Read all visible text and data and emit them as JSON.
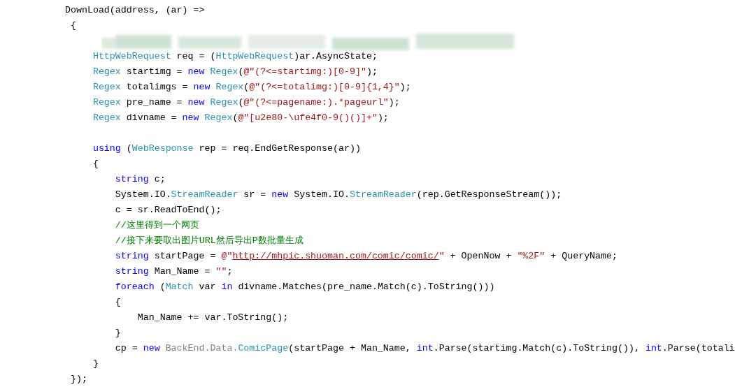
{
  "code_lines": [
    {
      "kind": "code",
      "tokens": [
        {
          "kind": "plain",
          "t": "DownLoad(address, (ar) =>"
        }
      ]
    },
    {
      "kind": "code",
      "tokens": [
        {
          "kind": "plain",
          "t": " {"
        }
      ]
    },
    {
      "kind": "blurred"
    },
    {
      "kind": "code",
      "tokens": [
        {
          "kind": "type",
          "t": "     HttpWebRequest"
        },
        {
          "kind": "plain",
          "t": " req = ("
        },
        {
          "kind": "type",
          "t": "HttpWebRequest"
        },
        {
          "kind": "plain",
          "t": ")ar.AsyncState;"
        }
      ]
    },
    {
      "kind": "code",
      "tokens": [
        {
          "kind": "type",
          "t": "     Regex"
        },
        {
          "kind": "plain",
          "t": " startimg = "
        },
        {
          "kind": "keyword",
          "t": "new "
        },
        {
          "kind": "type",
          "t": "Regex"
        },
        {
          "kind": "plain",
          "t": "("
        },
        {
          "kind": "string",
          "t": "@\"(?<=startimg:)[0-9]\""
        },
        {
          "kind": "plain",
          "t": ");"
        }
      ]
    },
    {
      "kind": "code",
      "tokens": [
        {
          "kind": "type",
          "t": "     Regex"
        },
        {
          "kind": "plain",
          "t": " totalimgs = "
        },
        {
          "kind": "keyword",
          "t": "new "
        },
        {
          "kind": "type",
          "t": "Regex"
        },
        {
          "kind": "plain",
          "t": "("
        },
        {
          "kind": "string",
          "t": "@\"(?<=totalimg:)[0-9]{1,4}\""
        },
        {
          "kind": "plain",
          "t": ");"
        }
      ]
    },
    {
      "kind": "code",
      "tokens": [
        {
          "kind": "type",
          "t": "     Regex"
        },
        {
          "kind": "plain",
          "t": " pre_name = "
        },
        {
          "kind": "keyword",
          "t": "new "
        },
        {
          "kind": "type",
          "t": "Regex"
        },
        {
          "kind": "plain",
          "t": "("
        },
        {
          "kind": "string",
          "t": "@\"(?<=pagename:).*pageurl\""
        },
        {
          "kind": "plain",
          "t": ");"
        }
      ]
    },
    {
      "kind": "code",
      "tokens": [
        {
          "kind": "type",
          "t": "     Regex"
        },
        {
          "kind": "plain",
          "t": " divname = "
        },
        {
          "kind": "keyword",
          "t": "new "
        },
        {
          "kind": "type",
          "t": "Regex"
        },
        {
          "kind": "plain",
          "t": "("
        },
        {
          "kind": "string",
          "t": "@\"[u2e80-\\ufe4f0-9()()]+\""
        },
        {
          "kind": "plain",
          "t": ");"
        }
      ]
    },
    {
      "kind": "blank"
    },
    {
      "kind": "code",
      "tokens": [
        {
          "kind": "keyword",
          "t": "     using"
        },
        {
          "kind": "plain",
          "t": " ("
        },
        {
          "kind": "type",
          "t": "WebResponse"
        },
        {
          "kind": "plain",
          "t": " rep = req.EndGetResponse(ar))"
        }
      ]
    },
    {
      "kind": "code",
      "tokens": [
        {
          "kind": "plain",
          "t": "     {"
        }
      ]
    },
    {
      "kind": "code",
      "tokens": [
        {
          "kind": "keyword",
          "t": "         string"
        },
        {
          "kind": "plain",
          "t": " c;"
        }
      ]
    },
    {
      "kind": "code",
      "tokens": [
        {
          "kind": "plain",
          "t": "         System.IO."
        },
        {
          "kind": "type",
          "t": "StreamReader"
        },
        {
          "kind": "plain",
          "t": " sr = "
        },
        {
          "kind": "keyword",
          "t": "new"
        },
        {
          "kind": "plain",
          "t": " System.IO."
        },
        {
          "kind": "type",
          "t": "StreamReader"
        },
        {
          "kind": "plain",
          "t": "(rep.GetResponseStream());"
        }
      ]
    },
    {
      "kind": "code",
      "tokens": [
        {
          "kind": "plain",
          "t": "         c = sr.ReadToEnd();"
        }
      ]
    },
    {
      "kind": "code",
      "tokens": [
        {
          "kind": "comment",
          "t": "         //这里得到一个网页"
        }
      ]
    },
    {
      "kind": "code",
      "tokens": [
        {
          "kind": "comment",
          "t": "         //接下来要取出图片URL然后导出P数批量生成"
        }
      ]
    },
    {
      "kind": "code",
      "tokens": [
        {
          "kind": "keyword",
          "t": "         string"
        },
        {
          "kind": "plain",
          "t": " startPage = "
        },
        {
          "kind": "string",
          "t": "@\""
        },
        {
          "kind": "link",
          "t": "http://mhpic.shuoman.com/comic/comic/"
        },
        {
          "kind": "string",
          "t": "\""
        },
        {
          "kind": "plain",
          "t": " + OpenNow + "
        },
        {
          "kind": "string",
          "t": "\"%2F\""
        },
        {
          "kind": "plain",
          "t": " + QueryName;"
        }
      ]
    },
    {
      "kind": "code",
      "tokens": [
        {
          "kind": "keyword",
          "t": "         string"
        },
        {
          "kind": "plain",
          "t": " Man_Name = "
        },
        {
          "kind": "string",
          "t": "\"\""
        },
        {
          "kind": "plain",
          "t": ";"
        }
      ]
    },
    {
      "kind": "code",
      "tokens": [
        {
          "kind": "keyword",
          "t": "         foreach"
        },
        {
          "kind": "plain",
          "t": " ("
        },
        {
          "kind": "type",
          "t": "Match"
        },
        {
          "kind": "plain",
          "t": " var "
        },
        {
          "kind": "keyword",
          "t": "in"
        },
        {
          "kind": "plain",
          "t": " divname.Matches(pre_name.Match(c).ToString()))"
        }
      ]
    },
    {
      "kind": "code",
      "tokens": [
        {
          "kind": "plain",
          "t": "         {"
        }
      ]
    },
    {
      "kind": "code",
      "tokens": [
        {
          "kind": "plain",
          "t": "             Man_Name += var.ToString();"
        }
      ]
    },
    {
      "kind": "code",
      "tokens": [
        {
          "kind": "plain",
          "t": "         }"
        }
      ]
    },
    {
      "kind": "code",
      "tokens": [
        {
          "kind": "plain",
          "t": "         cp = "
        },
        {
          "kind": "keyword",
          "t": "new "
        },
        {
          "kind": "namespace",
          "t": "BackEnd.Data."
        },
        {
          "kind": "type",
          "t": "ComicPage"
        },
        {
          "kind": "plain",
          "t": "(startPage + Man_Name, "
        },
        {
          "kind": "keyword",
          "t": "int"
        },
        {
          "kind": "plain",
          "t": ".Parse(startimg.Match(c).ToString()), "
        },
        {
          "kind": "keyword",
          "t": "int"
        },
        {
          "kind": "plain",
          "t": ".Parse(totali"
        }
      ]
    },
    {
      "kind": "code",
      "tokens": [
        {
          "kind": "plain",
          "t": "     }"
        }
      ]
    },
    {
      "kind": "code",
      "tokens": [
        {
          "kind": "plain",
          "t": " });"
        }
      ]
    }
  ]
}
